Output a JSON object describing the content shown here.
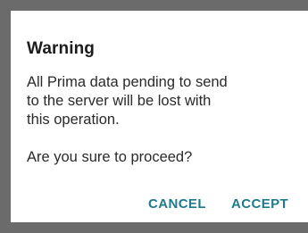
{
  "dialog": {
    "title": "Warning",
    "message": "All Prima data pending to send\nto the server will be lost with\nthis operation.\n\nAre you sure to proceed?",
    "actions": {
      "cancel_label": "CANCEL",
      "accept_label": "ACCEPT"
    },
    "colors": {
      "accent": "#1f7a8c",
      "scrim": "#6b6b6b",
      "surface": "#ffffff"
    }
  }
}
